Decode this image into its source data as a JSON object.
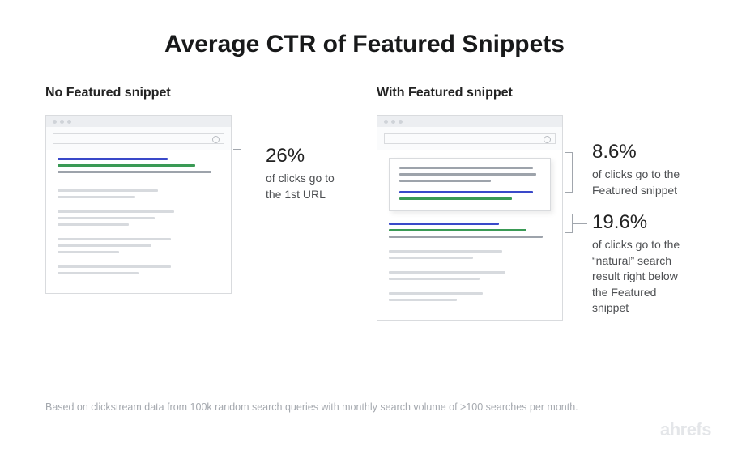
{
  "title": "Average CTR of Featured Snippets",
  "left": {
    "heading": "No Featured snippet",
    "stat": {
      "pct": "26%",
      "desc": "of clicks go to the 1st URL"
    }
  },
  "right": {
    "heading": "With Featured snippet",
    "snippet_stat": {
      "pct": "8.6%",
      "desc": "of clicks go to the Featured snippet"
    },
    "result_stat": {
      "pct": "19.6%",
      "desc": "of clicks go to the “natural” search result right below the Featured snippet"
    }
  },
  "footnote": "Based on clickstream data from 100k random search queries with monthly search volume of >100 searches per month.",
  "logo": "ahrefs"
}
